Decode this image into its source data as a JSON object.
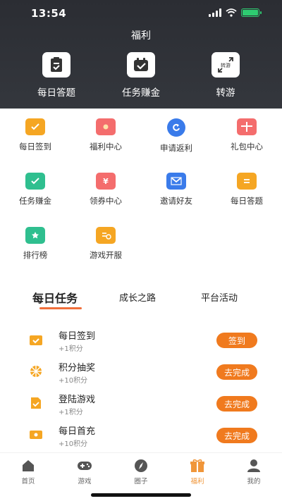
{
  "status_bar": {
    "time": "13:54"
  },
  "header": {
    "title": "福利"
  },
  "quick_actions": [
    {
      "label": "每日答题",
      "icon": "daily-quiz-icon"
    },
    {
      "label": "任务赚金",
      "icon": "task-earn-icon"
    },
    {
      "label": "转游",
      "icon": "transfer-game-icon",
      "badge": "转游"
    }
  ],
  "grid": [
    {
      "label": "每日签到",
      "icon": "calendar-check-icon",
      "color": "#f5a623"
    },
    {
      "label": "福利中心",
      "icon": "red-envelope-icon",
      "color": "#f46d6d"
    },
    {
      "label": "申请返利",
      "icon": "refund-icon",
      "color": "#3a7bea"
    },
    {
      "label": "礼包中心",
      "icon": "gift-icon",
      "color": "#f46d6d"
    },
    {
      "label": "任务赚金",
      "icon": "task-earn-icon",
      "color": "#2fbf8f"
    },
    {
      "label": "领券中心",
      "icon": "coupon-icon",
      "color": "#f46d6d"
    },
    {
      "label": "邀请好友",
      "icon": "invite-mail-icon",
      "color": "#3a7bea"
    },
    {
      "label": "每日答题",
      "icon": "quiz-icon",
      "color": "#f5a623"
    },
    {
      "label": "排行榜",
      "icon": "trophy-icon",
      "color": "#2fbf8f"
    },
    {
      "label": "游戏开服",
      "icon": "server-open-icon",
      "color": "#f5a623"
    }
  ],
  "tabs": [
    {
      "label": "每日任务",
      "active": true
    },
    {
      "label": "成长之路",
      "active": false
    },
    {
      "label": "平台活动",
      "active": false
    }
  ],
  "tasks": [
    {
      "title": "每日签到",
      "points": "+1积分",
      "button": "签到",
      "icon": "check-calendar-icon"
    },
    {
      "title": "积分抽奖",
      "points": "+10积分",
      "button": "去完成",
      "icon": "lottery-wheel-icon"
    },
    {
      "title": "登陆游戏",
      "points": "+1积分",
      "button": "去完成",
      "icon": "login-game-icon"
    },
    {
      "title": "每日首充",
      "points": "+10积分",
      "button": "去完成",
      "icon": "recharge-icon"
    }
  ],
  "bottom_nav": [
    {
      "label": "首页",
      "icon": "home-icon",
      "active": false
    },
    {
      "label": "游戏",
      "icon": "gamepad-icon",
      "active": false
    },
    {
      "label": "圈子",
      "icon": "compass-icon",
      "active": false
    },
    {
      "label": "福利",
      "icon": "gift-icon",
      "active": true
    },
    {
      "label": "我的",
      "icon": "user-icon",
      "active": false
    }
  ]
}
